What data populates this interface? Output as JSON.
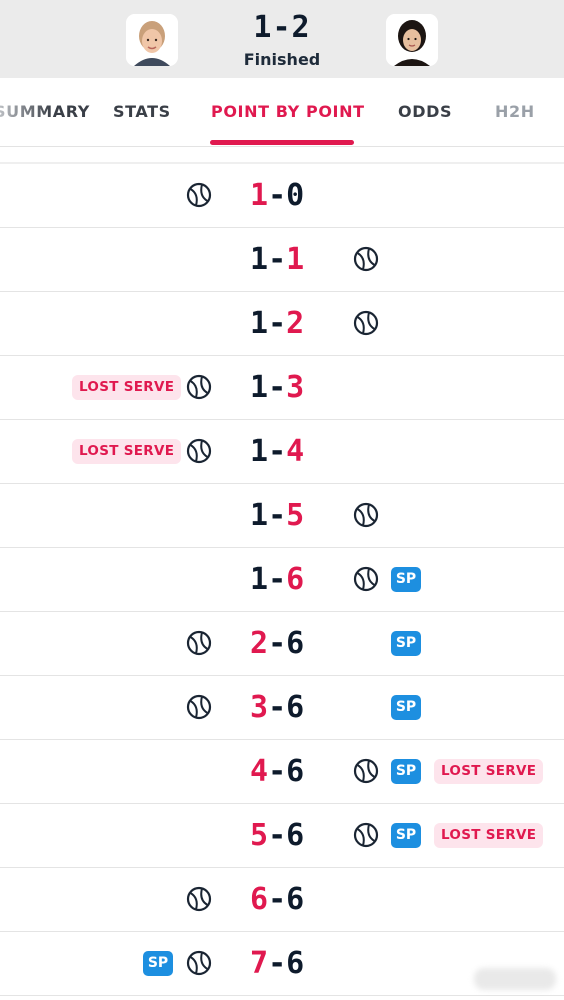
{
  "match": {
    "score": "1-2",
    "status": "Finished"
  },
  "tabs": [
    "SUMMARY",
    "STATS",
    "POINT BY POINT",
    "ODDS",
    "H2H"
  ],
  "active_tab": "POINT BY POINT",
  "labels": {
    "lost_serve": "LOST SERVE",
    "set_point": "SP"
  },
  "colors": {
    "accent": "#e0194f",
    "sp_blue": "#1d8fe0",
    "lost_bg": "#fde4ec",
    "text_dark": "#0e1b2c"
  },
  "games": [
    {
      "home": "1",
      "away": "0",
      "highlight": "home",
      "server": "home"
    },
    {
      "home": "1",
      "away": "1",
      "highlight": "away",
      "server": "away"
    },
    {
      "home": "1",
      "away": "2",
      "highlight": "away",
      "server": "away"
    },
    {
      "home": "1",
      "away": "3",
      "highlight": "away",
      "server": "home",
      "lost_serve": "home"
    },
    {
      "home": "1",
      "away": "4",
      "highlight": "away",
      "server": "home",
      "lost_serve": "home"
    },
    {
      "home": "1",
      "away": "5",
      "highlight": "away",
      "server": "away"
    },
    {
      "home": "1",
      "away": "6",
      "highlight": "away",
      "server": "away",
      "sp": "away"
    },
    {
      "home": "2",
      "away": "6",
      "highlight": "home",
      "server": "home",
      "sp": "away"
    },
    {
      "home": "3",
      "away": "6",
      "highlight": "home",
      "server": "home",
      "sp": "away"
    },
    {
      "home": "4",
      "away": "6",
      "highlight": "home",
      "server": "away",
      "sp": "away",
      "lost_serve": "away"
    },
    {
      "home": "5",
      "away": "6",
      "highlight": "home",
      "server": "away",
      "sp": "away",
      "lost_serve": "away"
    },
    {
      "home": "6",
      "away": "6",
      "highlight": "home",
      "server": "home"
    },
    {
      "home": "7",
      "away": "6",
      "highlight": "home",
      "server": "home",
      "sp": "home"
    }
  ]
}
